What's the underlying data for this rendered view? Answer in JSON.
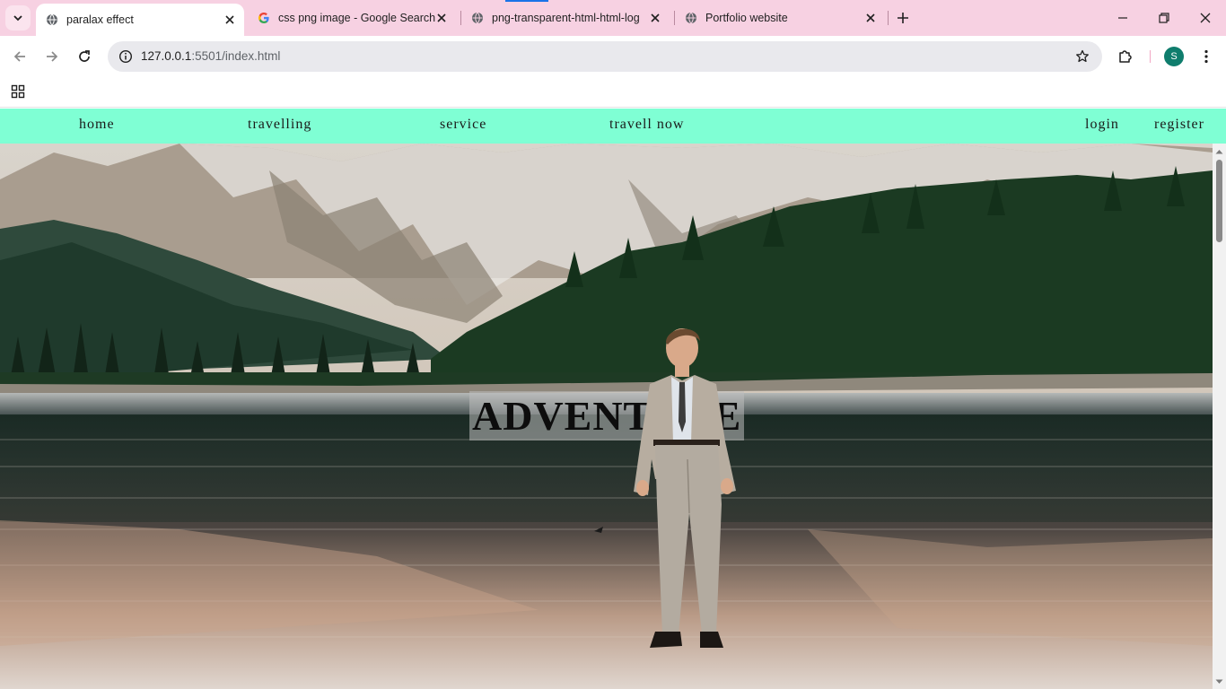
{
  "browser": {
    "tabs": [
      {
        "title": "paralax effect",
        "favicon": "globe-icon",
        "active": true
      },
      {
        "title": "css png image - Google Search",
        "favicon": "google-icon",
        "active": false
      },
      {
        "title": "png-transparent-html-html-log",
        "favicon": "globe-icon",
        "active": false
      },
      {
        "title": "Portfolio website",
        "favicon": "globe-icon",
        "active": false
      }
    ],
    "url_host": "127.0.0.1",
    "url_rest": ":5501/index.html",
    "profile_initial": "S"
  },
  "page": {
    "nav": {
      "home": "home",
      "travelling": "travelling",
      "service": "service",
      "travell_now": "travell now",
      "login": "login",
      "register": "register"
    },
    "headline": "ADVENTURE"
  },
  "colors": {
    "tabstrip": "#f7d1e2",
    "nav_bg": "#7fffd4",
    "avatar": "#0f7d6d"
  }
}
